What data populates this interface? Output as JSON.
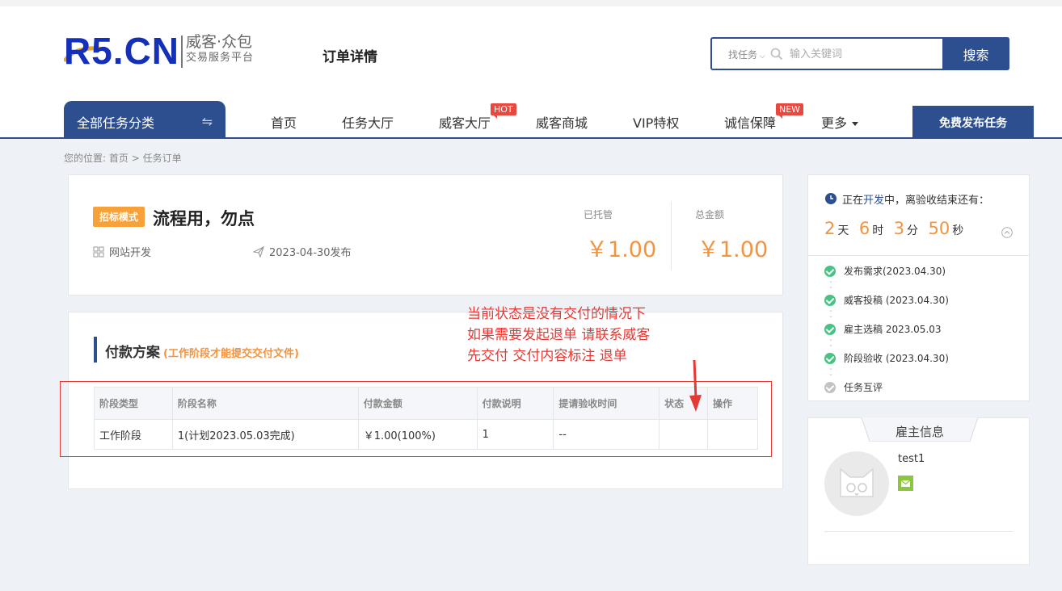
{
  "brand": {
    "logo_mark": "R5.CN",
    "name_line1": "威客·众包",
    "name_line2": "交易服务平台",
    "colors": {
      "primary": "#2d4f8f",
      "accent": "#f4933c",
      "danger": "#e53935",
      "success": "#48c285"
    }
  },
  "header": {
    "page_title": "订单详情",
    "search_type": "找任务",
    "search_placeholder": "输入关键词",
    "search_button": "搜索"
  },
  "nav": {
    "category_label": "全部任务分类",
    "items": [
      "首页",
      "任务大厅",
      "威客大厅",
      "威客商城",
      "VIP特权",
      "诚信保障",
      "更多"
    ],
    "badge_hot": "HOT",
    "badge_new": "NEW",
    "publish_button": "免费发布任务"
  },
  "breadcrumb": {
    "prefix": "您的位置:",
    "home": "首页",
    "sep": ">",
    "current": "任务订单"
  },
  "task": {
    "mode": "招标模式",
    "title": "流程用，勿点",
    "category": "网站开发",
    "published": "2023-04-30发布",
    "escrow_label": "已托管",
    "escrow_value": "￥1.00",
    "total_label": "总金额",
    "total_value": "￥1.00"
  },
  "payment": {
    "title": "付款方案",
    "note": "(工作阶段才能提交交付文件)",
    "columns": [
      "阶段类型",
      "阶段名称",
      "付款金额",
      "付款说明",
      "提请验收时间",
      "状态",
      "操作"
    ],
    "rows": [
      [
        "工作阶段",
        "1(计划2023.05.03完成)",
        "￥1.00(100%)",
        "1",
        "--",
        "",
        ""
      ]
    ]
  },
  "annotation": {
    "lines": [
      "当前状态是没有交付的情况下",
      "如果需要发起退单 请联系威客",
      "先交付 交付内容标注 退单"
    ]
  },
  "status": {
    "prefix": "正在",
    "highlight": "开发",
    "suffix": "中，离验收结束还有：",
    "countdown": {
      "days": "2",
      "days_unit": "天",
      "hours": "6",
      "hours_unit": "时",
      "minutes": "3",
      "minutes_unit": "分",
      "seconds": "50",
      "seconds_unit": "秒"
    },
    "steps": [
      "发布需求(2023.04.30)",
      "威客投稿 (2023.04.30)",
      "雇主选稿 2023.05.03",
      "阶段验收 (2023.04.30)",
      "任务互评"
    ]
  },
  "employer": {
    "title": "雇主信息",
    "name": "test1"
  }
}
